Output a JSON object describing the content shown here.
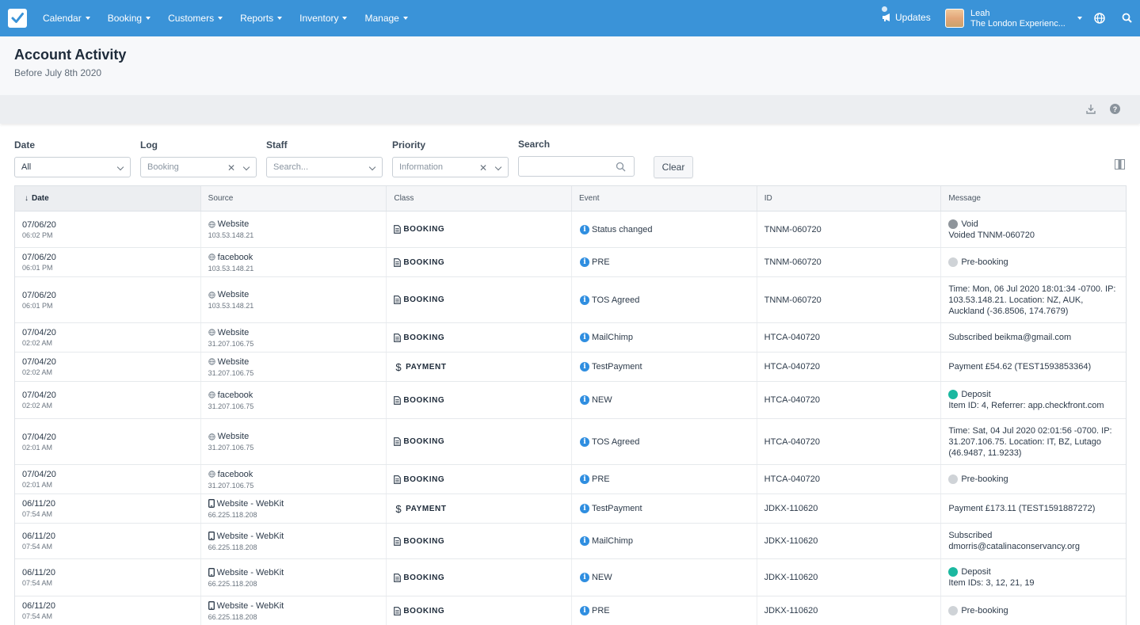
{
  "nav": {
    "items": [
      "Calendar",
      "Booking",
      "Customers",
      "Reports",
      "Inventory",
      "Manage"
    ],
    "updates_label": "Updates",
    "user_name": "Leah",
    "user_company": "The London Experienc..."
  },
  "page": {
    "title": "Account Activity",
    "subtitle": "Before July 8th 2020"
  },
  "filters": {
    "date": {
      "label": "Date",
      "value": "All"
    },
    "log": {
      "label": "Log",
      "value": "Booking"
    },
    "staff": {
      "label": "Staff",
      "placeholder": "Search..."
    },
    "priority": {
      "label": "Priority",
      "value": "Information"
    },
    "search": {
      "label": "Search",
      "value": ""
    },
    "clear_label": "Clear"
  },
  "table": {
    "headers": [
      "Date",
      "Source",
      "Class",
      "Event",
      "ID",
      "Message"
    ],
    "rows": [
      {
        "date": "07/06/20",
        "time": "06:02 PM",
        "source": "Website",
        "source_icon": "globe",
        "ip": "103.53.148.21",
        "class": "BOOKING",
        "event": "Status changed",
        "id": "TNNM-060720",
        "status": "Void",
        "status_color": "#8f959b",
        "message": "Voided TNNM-060720"
      },
      {
        "date": "07/06/20",
        "time": "06:01 PM",
        "source": "facebook",
        "source_icon": "globe",
        "ip": "103.53.148.21",
        "class": "BOOKING",
        "event": "PRE",
        "id": "TNNM-060720",
        "status": "Pre-booking",
        "status_color": "#cfd3d7",
        "message": ""
      },
      {
        "date": "07/06/20",
        "time": "06:01 PM",
        "source": "Website",
        "source_icon": "globe",
        "ip": "103.53.148.21",
        "class": "BOOKING",
        "event": "TOS Agreed",
        "id": "TNNM-060720",
        "status": "",
        "status_color": "",
        "message": "Time: Mon, 06 Jul 2020 18:01:34 -0700. IP: 103.53.148.21. Location: NZ, AUK, Auckland (-36.8506, 174.7679)"
      },
      {
        "date": "07/04/20",
        "time": "02:02 AM",
        "source": "Website",
        "source_icon": "globe",
        "ip": "31.207.106.75",
        "class": "BOOKING",
        "event": "MailChimp",
        "id": "HTCA-040720",
        "status": "",
        "status_color": "",
        "message": "Subscribed beikma@gmail.com"
      },
      {
        "date": "07/04/20",
        "time": "02:02 AM",
        "source": "Website",
        "source_icon": "globe",
        "ip": "31.207.106.75",
        "class": "PAYMENT",
        "event": "TestPayment",
        "id": "HTCA-040720",
        "status": "",
        "status_color": "",
        "message": "Payment £54.62 (TEST1593853364)"
      },
      {
        "date": "07/04/20",
        "time": "02:02 AM",
        "source": "facebook",
        "source_icon": "globe",
        "ip": "31.207.106.75",
        "class": "BOOKING",
        "event": "NEW",
        "id": "HTCA-040720",
        "status": "Deposit",
        "status_color": "#1bb8a0",
        "message": "Item ID: 4, Referrer: app.checkfront.com"
      },
      {
        "date": "07/04/20",
        "time": "02:01 AM",
        "source": "Website",
        "source_icon": "globe",
        "ip": "31.207.106.75",
        "class": "BOOKING",
        "event": "TOS Agreed",
        "id": "HTCA-040720",
        "status": "",
        "status_color": "",
        "message": "Time: Sat, 04 Jul 2020 02:01:56 -0700. IP: 31.207.106.75. Location: IT, BZ, Lutago (46.9487, 11.9233)"
      },
      {
        "date": "07/04/20",
        "time": "02:01 AM",
        "source": "facebook",
        "source_icon": "globe",
        "ip": "31.207.106.75",
        "class": "BOOKING",
        "event": "PRE",
        "id": "HTCA-040720",
        "status": "Pre-booking",
        "status_color": "#cfd3d7",
        "message": ""
      },
      {
        "date": "06/11/20",
        "time": "07:54 AM",
        "source": "Website - WebKit",
        "source_icon": "mobile",
        "ip": "66.225.118.208",
        "class": "PAYMENT",
        "event": "TestPayment",
        "id": "JDKX-110620",
        "status": "",
        "status_color": "",
        "message": "Payment £173.11 (TEST1591887272)"
      },
      {
        "date": "06/11/20",
        "time": "07:54 AM",
        "source": "Website - WebKit",
        "source_icon": "mobile",
        "ip": "66.225.118.208",
        "class": "BOOKING",
        "event": "MailChimp",
        "id": "JDKX-110620",
        "status": "",
        "status_color": "",
        "message": "Subscribed dmorris@catalinaconservancy.org"
      },
      {
        "date": "06/11/20",
        "time": "07:54 AM",
        "source": "Website - WebKit",
        "source_icon": "mobile",
        "ip": "66.225.118.208",
        "class": "BOOKING",
        "event": "NEW",
        "id": "JDKX-110620",
        "status": "Deposit",
        "status_color": "#1bb8a0",
        "message": "Item IDs: 3, 12, 21, 19"
      },
      {
        "date": "06/11/20",
        "time": "07:54 AM",
        "source": "Website - WebKit",
        "source_icon": "mobile",
        "ip": "66.225.118.208",
        "class": "BOOKING",
        "event": "PRE",
        "id": "JDKX-110620",
        "status": "Pre-booking",
        "status_color": "#cfd3d7",
        "message": ""
      }
    ]
  },
  "colors": {
    "topbar": "#3a93d8",
    "info_icon": "#2f8ee0"
  }
}
